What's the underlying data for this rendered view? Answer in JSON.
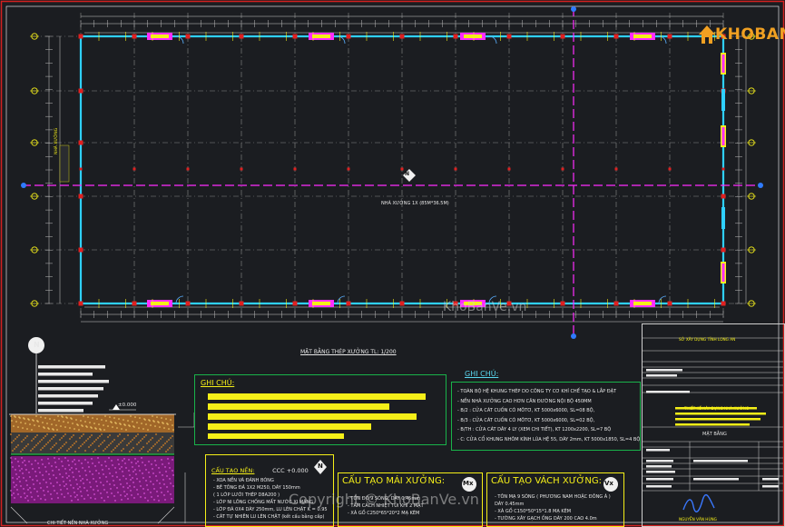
{
  "logo": {
    "text": "KHOBANVE",
    "accent": "#f0a022"
  },
  "watermarks": [
    "KhoBanVe.vn",
    "Copyright © KhoBanVe.vn"
  ],
  "plan": {
    "title": "MẶT BẰNG THÉP XƯỞNG TL: 1/200",
    "hall_label": "NHÀ XƯỞNG 1X (85M*36.5M)",
    "section_marker": "N",
    "side_label": "NHÀ XƯỞNG"
  },
  "section": {
    "marker": "N",
    "level": "±0.000",
    "caption": "CHI TIẾT NỀN NHÀ XƯỞNG"
  },
  "notes_left": {
    "heading": "GHI CHÚ:"
  },
  "notes_right": {
    "heading": "GHI CHÚ:",
    "lines": [
      "- TOÀN BỘ HỆ KHUNG THÉP DO CÔNG TY CƠ KHÍ CHẾ TẠO & LẮP ĐẶT",
      "- NỀN NHÀ XƯỞNG CAO HƠN CÂN ĐƯỜNG NỘI BỘ 450MM",
      "- B/2 : CỬA CÁT CUỐN CÓ MÔTƠ, KT 5000x6000, SL=08 BỘ,",
      "- B/3 : CỬA CÁT CUỐN CÓ MÔTƠ, KT 5000x6000, SL=02 BỘ,",
      "- B/TH : CỬA CÁT DÂY 4 LY (XEM CHI TIẾT), KT 1200x2200, SL=7 BỘ",
      "- C: CỬA CỔ KHUNG NHÔM KÍNH LÙA HỆ 55, DÀY 2mm, KT 5000x1850, SL=4 BỘ"
    ]
  },
  "foundation": {
    "heading": "CẤU TẠO NỀN:",
    "level": "CCC +0.000",
    "marker": "N",
    "lines": [
      "- XOA NỀN VÀ ĐÁNH BÓNG",
      "- BÊ TÔNG ĐÁ 1X2 M250, DÀY 150mm",
      "  ( 1 LỚP LƯỚI THÉP D8A200 )",
      "- LỚP NI LÔNG CHỐNG MẤT NƯỚC XI MĂNG",
      "- LỚP ĐÁ 0X4 DÀY 250mm, LU LÈN CHẶT K = 0.95",
      "- CÁT TỰ NHIÊN LU LÈN CHẶT (kết cấu bằng cấp)"
    ]
  },
  "roof": {
    "heading": "CẤU TẠO MÁI XƯỞNG:",
    "marker": "Mx",
    "lines": [
      "- TÔN ĐỐ 9 SÓNG, DÀY 0.45mm",
      "- TẤM CÁCH NHIỆT TÚI KHÍ 2 MẶT",
      "- XÀ GỒ C250*65*20*2 MẠ KẼM"
    ]
  },
  "wall": {
    "heading": "CẤU TẠO VÁCH XƯỞNG:",
    "marker": "Vx",
    "lines": [
      "- TÔN MẠ 9 SÓNG ( PHƯƠNG NAM HOẶC ĐÔNG Á )",
      "  DÀY 0.45mm",
      "- XÀ GỒ C150*50*15*1.8 MẠ KẼM",
      "- TƯỜNG XÂY GẠCH ỐNG DÀY 200 CAO 4.0m"
    ]
  },
  "title_block": {
    "company": "SỞ XÂY DỰNG TỈNH LONG AN",
    "project": "THIẾT KẾ XÂY DỰNG NHÀ XƯỞNG",
    "sheet": "MẶT BẰNG",
    "signer": "NGUYỄN VĂN HÙNG"
  }
}
